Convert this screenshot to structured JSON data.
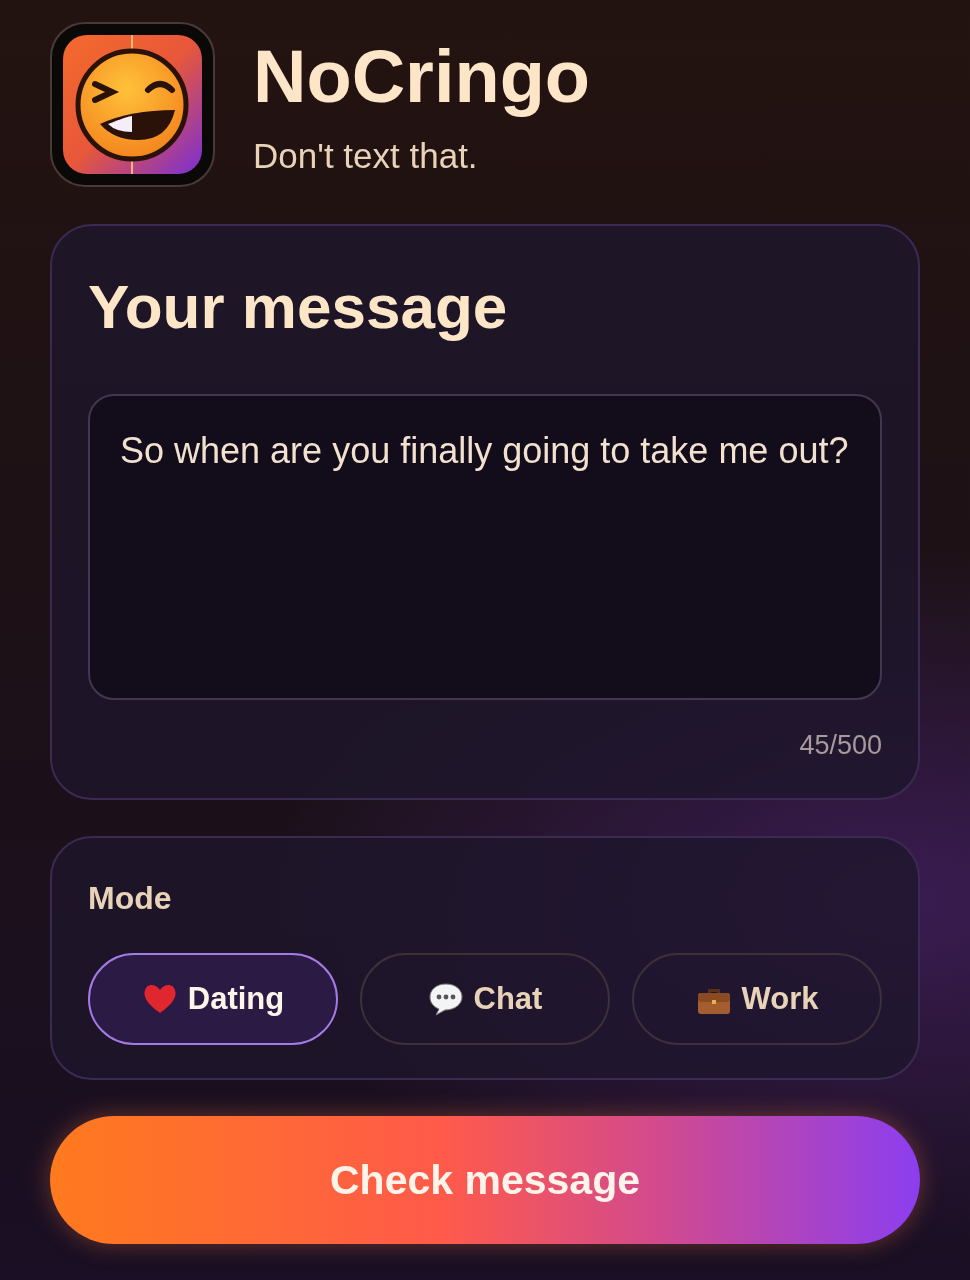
{
  "app": {
    "name": "NoCringo",
    "tagline": "Don't text that."
  },
  "message_card": {
    "title": "Your message",
    "value": "So when are you finally going to take me out?",
    "counter": "45/500"
  },
  "mode_card": {
    "label": "Mode",
    "modes": [
      {
        "kind": "heart",
        "label": "Dating",
        "selected": true
      },
      {
        "kind": "speech",
        "label": "Chat",
        "selected": false
      },
      {
        "kind": "briefcase",
        "label": "Work",
        "selected": false
      }
    ]
  },
  "action": {
    "label": "Check message"
  }
}
